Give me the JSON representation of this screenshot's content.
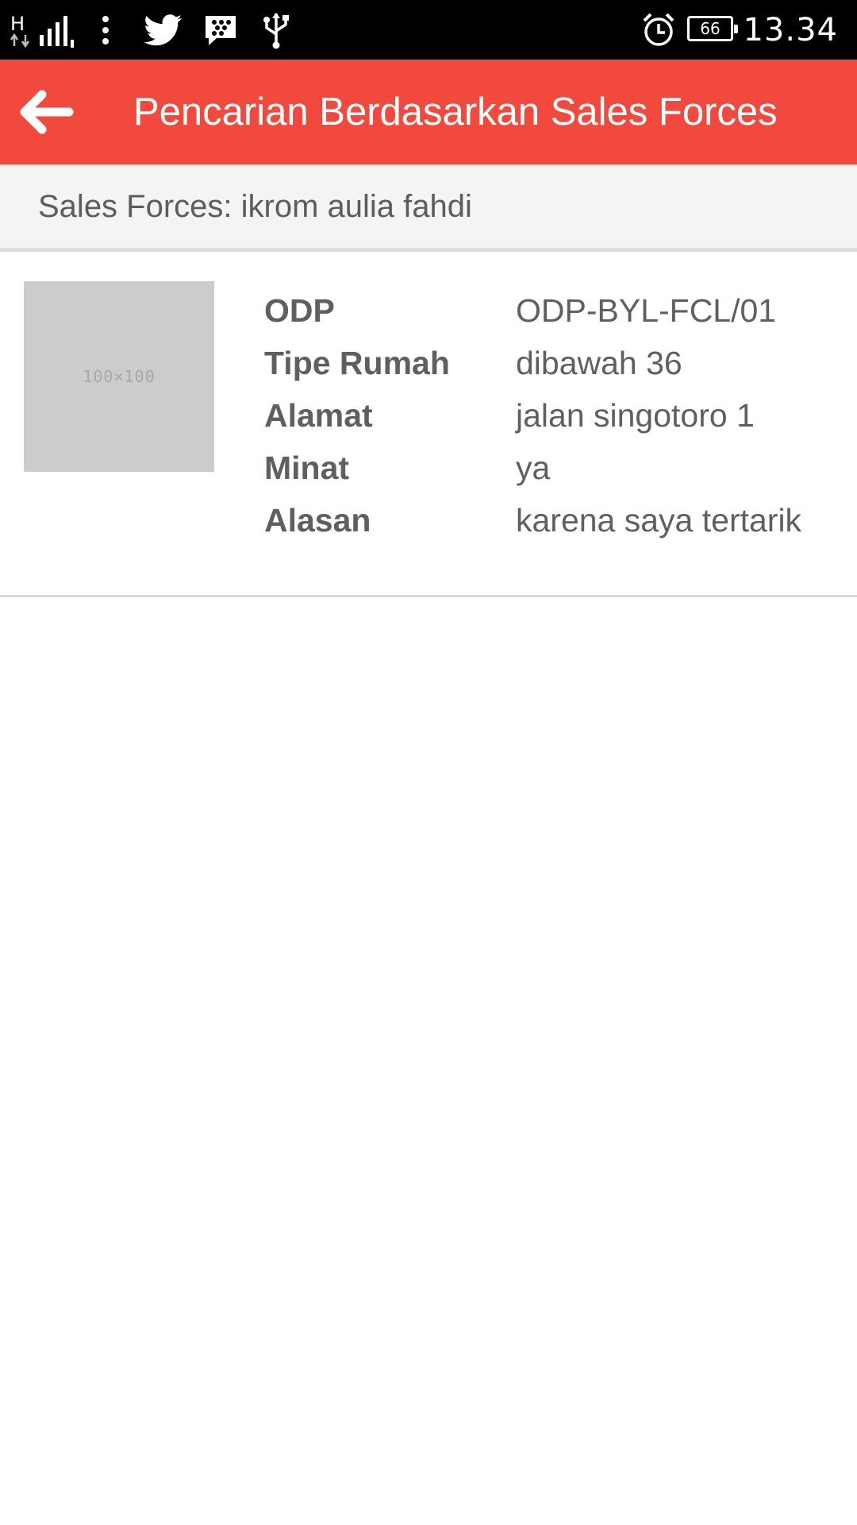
{
  "status_bar": {
    "network_type": "H",
    "battery_level": "66",
    "clock": "13.34",
    "icons": [
      "hspa-icon",
      "signal-icon",
      "overflow-icon",
      "twitter-icon",
      "bbm-icon",
      "usb-icon",
      "alarm-icon",
      "battery-icon"
    ]
  },
  "toolbar": {
    "back_icon": "arrow-back-icon",
    "title": "Pencarian Berdasarkan Sales Forces",
    "background_color": "#f1493d"
  },
  "sub_header": {
    "text": "Sales Forces: ikrom aulia fahdi"
  },
  "results": [
    {
      "thumbnail_text": "100×100",
      "fields": [
        {
          "label": "ODP",
          "value": "ODP-BYL-FCL/01"
        },
        {
          "label": "Tipe Rumah",
          "value": "dibawah 36"
        },
        {
          "label": "Alamat",
          "value": "jalan singotoro 1"
        },
        {
          "label": "Minat",
          "value": "ya"
        },
        {
          "label": "Alasan",
          "value": "karena saya tertarik"
        }
      ]
    }
  ]
}
